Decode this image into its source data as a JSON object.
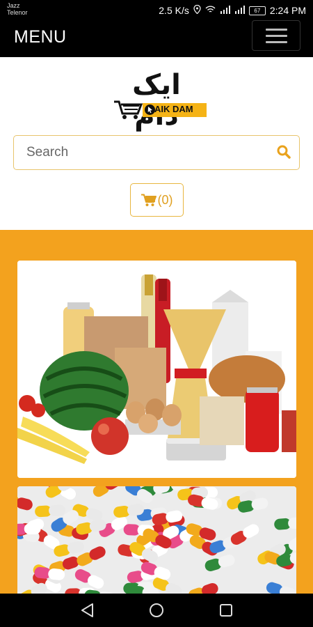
{
  "status_bar": {
    "carrier_line1": "Jazz",
    "carrier_line2": "Telenor",
    "net_speed": "2.5 K/s",
    "battery": "67",
    "time": "2:24 PM"
  },
  "navbar": {
    "menu_label": "MENU"
  },
  "logo": {
    "urdu_text": "ایک دام",
    "english_text": "AIK DAM"
  },
  "search": {
    "placeholder": "Search"
  },
  "cart": {
    "count_label": "(0)"
  },
  "icons": {
    "location": "location-icon",
    "wifi": "wifi-icon",
    "signal": "signal-icon",
    "battery": "battery-icon",
    "hamburger": "hamburger-icon",
    "search": "search-icon",
    "cart": "cart-icon",
    "back": "back-icon",
    "home": "home-icon",
    "recents": "recents-icon"
  },
  "colors": {
    "accent": "#f3a21e",
    "navbar": "#000000",
    "brand_yellow": "#f5b316"
  }
}
